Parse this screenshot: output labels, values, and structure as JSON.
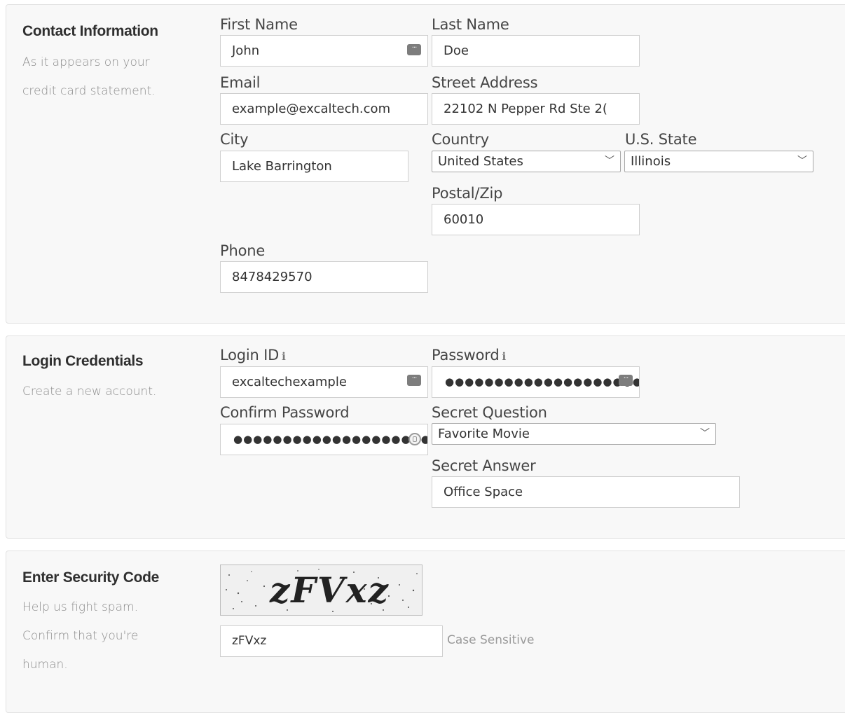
{
  "contact": {
    "title": "Contact Information",
    "desc_line1": "As it appears on your",
    "desc_line2": "credit card statement.",
    "first_name": {
      "label": "First Name",
      "value": "John"
    },
    "last_name": {
      "label": "Last Name",
      "value": "Doe"
    },
    "email": {
      "label": "Email",
      "value": "example@excaltech.com"
    },
    "street": {
      "label": "Street Address",
      "value": "22102 N Pepper Rd Ste 2("
    },
    "city": {
      "label": "City",
      "value": "Lake Barrington"
    },
    "country": {
      "label": "Country",
      "value": "United States"
    },
    "state": {
      "label": "U.S. State",
      "value": "Illinois"
    },
    "postal": {
      "label": "Postal/Zip",
      "value": "60010"
    },
    "phone": {
      "label": "Phone",
      "value": "8478429570"
    }
  },
  "login": {
    "title": "Login Credentials",
    "desc": "Create a new account.",
    "login_id": {
      "label": "Login ID",
      "info": "i",
      "value": "excaltechexample"
    },
    "password": {
      "label": "Password",
      "info": "i",
      "value": "●●●●●●●●●●●●●●●●●●●●"
    },
    "confirm_password": {
      "label": "Confirm Password",
      "value": "●●●●●●●●●●●●●●●●●●●●●"
    },
    "secret_question": {
      "label": "Secret Question",
      "value": "Favorite Movie"
    },
    "secret_answer": {
      "label": "Secret Answer",
      "value": "Office Space"
    }
  },
  "security": {
    "title": "Enter Security Code",
    "desc_line1": "Help us fight spam.",
    "desc_line2": "Confirm that you're",
    "desc_line3": "human.",
    "captcha_text": "zFVxz",
    "code_value": "zFVxz",
    "case_note": "Case Sensitive"
  },
  "icons": {
    "autofill": "key-dots-icon",
    "reveal": "password-reveal-icon",
    "chevron": "chevron-down-icon"
  }
}
